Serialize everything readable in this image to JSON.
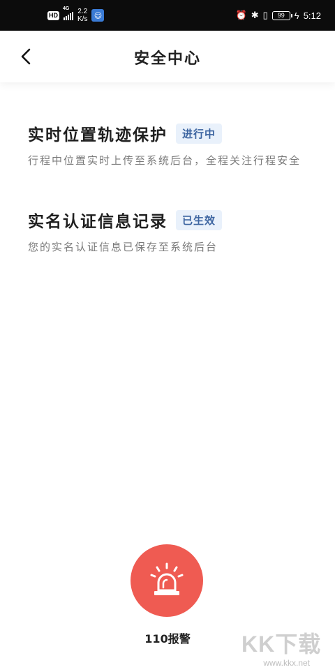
{
  "status_bar": {
    "left_badge": "HD",
    "network": "4G",
    "speed_value": "2.2",
    "speed_unit": "K/s",
    "battery": "99",
    "time": "5:12"
  },
  "header": {
    "title": "安全中心"
  },
  "items": [
    {
      "title": "实时位置轨迹保护",
      "badge": "进行中",
      "desc": "行程中位置实时上传至系统后台，全程关注行程安全"
    },
    {
      "title": "实名认证信息记录",
      "badge": "已生效",
      "desc": "您的实名认证信息已保存至系统后台"
    }
  ],
  "alarm": {
    "label": "110报警"
  },
  "watermark": {
    "main": "KK下载",
    "sub": "www.kkx.net"
  }
}
